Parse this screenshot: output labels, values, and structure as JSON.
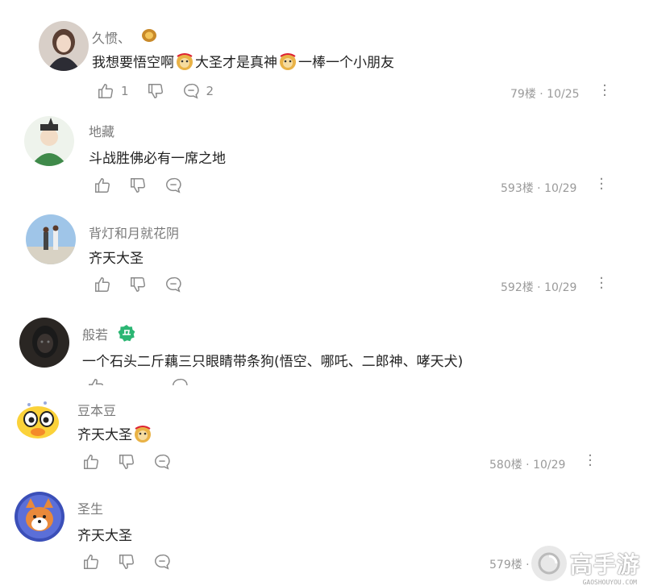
{
  "comments": [
    {
      "username": "久惯、",
      "text_parts": [
        "我想要悟空啊",
        "大圣才是真神",
        "一棒一个小朋友"
      ],
      "likes": "1",
      "replies": "2",
      "meta": "79楼 · 10/25"
    },
    {
      "username": "地藏",
      "text": "斗战胜佛必有一席之地",
      "meta": "593楼 · 10/29"
    },
    {
      "username": "背灯和月就花阴",
      "text": "齐天大圣",
      "meta": "592楼 · 10/29"
    },
    {
      "username": "般若",
      "text": "一个石头二斤藕三只眼睛带条狗(悟空、哪吒、二郎神、哮天犬)"
    },
    {
      "username": "豆本豆",
      "text": "齐天大圣",
      "meta": "580楼 · 10/29"
    },
    {
      "username": "圣生",
      "text": "齐天大圣",
      "meta": "579楼 · 10/"
    }
  ],
  "watermark": {
    "text": "高手游",
    "sub": "GAOSHOUYOU.COM"
  },
  "colors": {
    "badge_green": "#2bb673",
    "icon_gray": "#8a8a8a",
    "meta_gray": "#9a9a9a"
  }
}
